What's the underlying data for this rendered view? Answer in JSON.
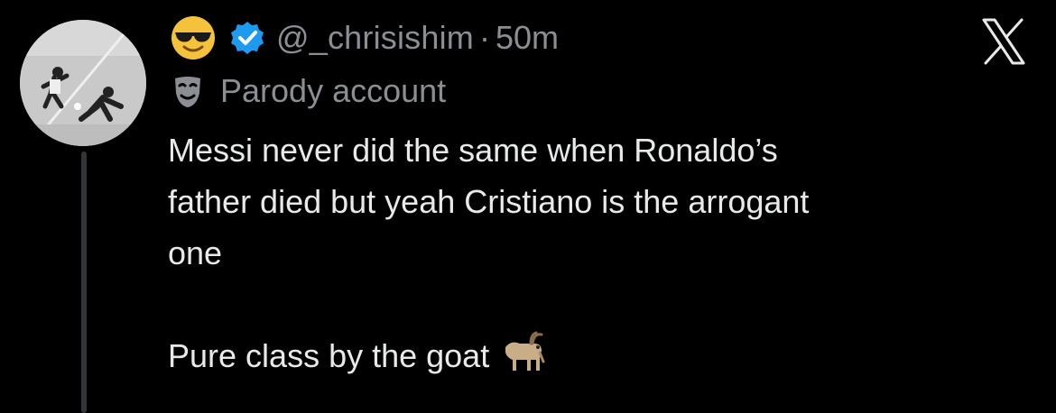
{
  "header": {
    "emoji": "smiling-face-with-sunglasses",
    "verified_icon": "verified-badge-icon",
    "handle": "@_chrisishim",
    "separator": "·",
    "time": "50m"
  },
  "parody": {
    "icon": "theater-mask-icon",
    "label": "Parody account"
  },
  "tweet": {
    "line1": "Messi never did the same when Ronaldo’s",
    "line2": "father died but yeah Cristiano is the arrogant",
    "line3": "one",
    "line4": "Pure class by the goat",
    "trailing_emoji": "goat"
  },
  "colors": {
    "background": "#000000",
    "text": "#e7e9ea",
    "secondary": "#8b8f94",
    "verified": "#1d9bf0"
  }
}
